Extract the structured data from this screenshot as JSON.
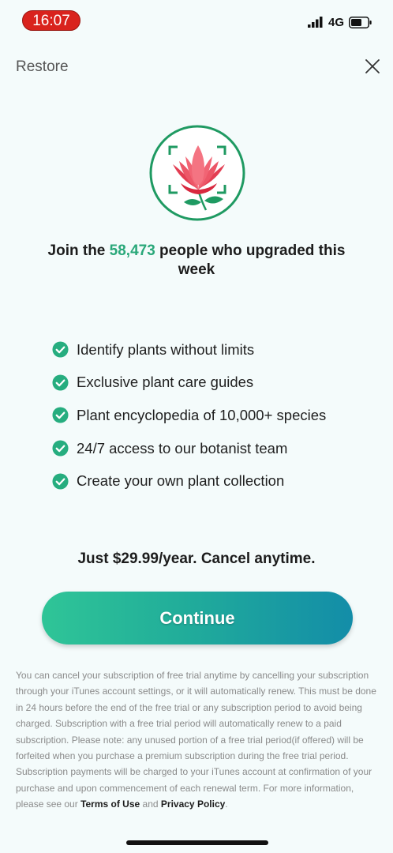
{
  "status_bar": {
    "time": "16:07",
    "network": "4G",
    "colors": {
      "time_pill": "#d9231d"
    }
  },
  "header": {
    "restore_label": "Restore",
    "close_icon": "close-icon"
  },
  "logo": {
    "icon": "rose-scan-logo"
  },
  "headline": {
    "prefix": "Join the ",
    "count": "58,473",
    "suffix": " people who upgraded this week"
  },
  "features": [
    {
      "icon": "check-circle-icon",
      "label": "Identify plants without limits"
    },
    {
      "icon": "check-circle-icon",
      "label": "Exclusive plant care guides"
    },
    {
      "icon": "check-circle-icon",
      "label": "Plant encyclopedia of 10,000+ species"
    },
    {
      "icon": "check-circle-icon",
      "label": "24/7 access to our botanist team"
    },
    {
      "icon": "check-circle-icon",
      "label": "Create your own plant collection"
    }
  ],
  "pricing": {
    "text": "Just $29.99/year. Cancel anytime."
  },
  "cta": {
    "label": "Continue"
  },
  "legal": {
    "body": "You can cancel your subscription of free trial anytime by cancelling your subscription through your iTunes account settings, or it will automatically renew. This must be done in 24 hours before the end of the free trial or any subscription period to avoid being charged. Subscription with a free trial period will automatically renew to a paid subscription. Please note: any unused portion of a free trial period(if offered) will be forfeited when you purchase a premium subscription during the free trial period. Subscription payments will be charged to your iTunes account at confirmation of your purchase and upon commencement of each renewal term. For more information, please see our ",
    "terms_label": "Terms of Use",
    "and_text": " and ",
    "privacy_label": "Privacy Policy",
    "end_text": "."
  },
  "colors": {
    "accent": "#2aa87a",
    "background": "#f4fbfb",
    "button_start": "#2fc597",
    "button_end": "#138da8"
  }
}
